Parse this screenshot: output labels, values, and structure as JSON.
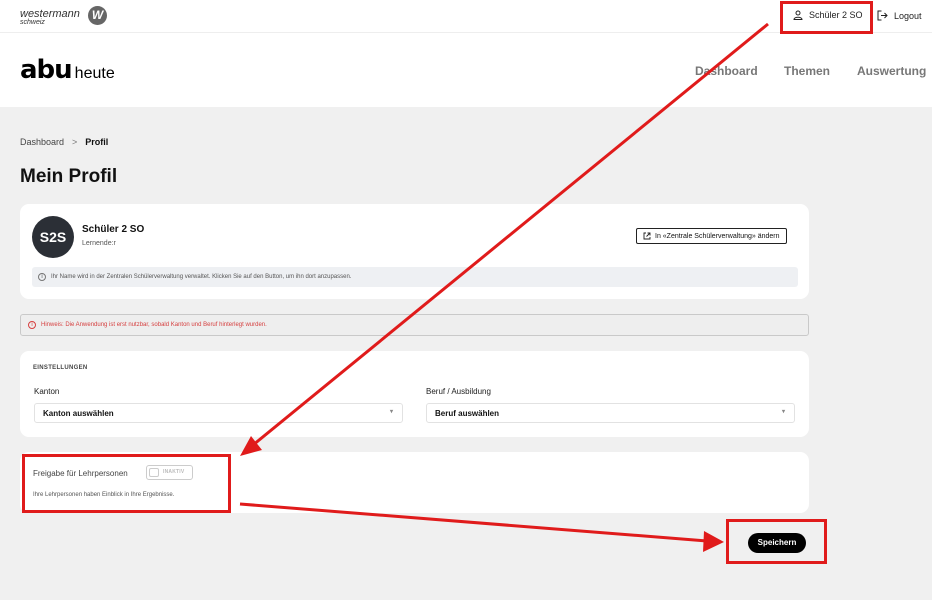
{
  "topbar": {
    "brand_main": "westermann",
    "brand_sub": "schweiz",
    "brand_badge": "W",
    "user_label": "Schüler 2 SO",
    "logout_label": "Logout"
  },
  "header": {
    "logo_main": "abu",
    "logo_sub": "heute",
    "nav": [
      "Dashboard",
      "Themen",
      "Auswertung"
    ]
  },
  "breadcrumb": {
    "items": [
      "Dashboard",
      "Profil"
    ],
    "separator": ">"
  },
  "page_title": "Mein Profil",
  "profile": {
    "initials": "S2S",
    "name": "Schüler 2 SO",
    "role": "Lernende:r",
    "change_button": "In «Zentrale Schülerverwaltung» ändern",
    "info_text": "Ihr Name wird in der Zentralen Schülerverwaltung verwaltet. Klicken Sie auf den Button, um ihn dort anzupassen."
  },
  "alert": {
    "text": "Hinweis: Die Anwendung ist erst nutzbar, sobald Kanton und Beruf hinterlegt wurden."
  },
  "settings": {
    "title": "EINSTELLUNGEN",
    "kanton_label": "Kanton",
    "kanton_value": "Kanton auswählen",
    "beruf_label": "Beruf / Ausbildung",
    "beruf_value": "Beruf auswählen"
  },
  "sharing": {
    "label": "Freigabe für Lehrpersonen",
    "toggle_state": "INAKTIV",
    "hint": "Ihre Lehrpersonen haben Einblick in Ihre Ergebnisse."
  },
  "save_label": "Speichern",
  "colors": {
    "annotation_red": "#e01b1b",
    "alert_red": "#d64040",
    "avatar_bg": "#2b2f36",
    "page_bg": "#f0f0f0"
  }
}
